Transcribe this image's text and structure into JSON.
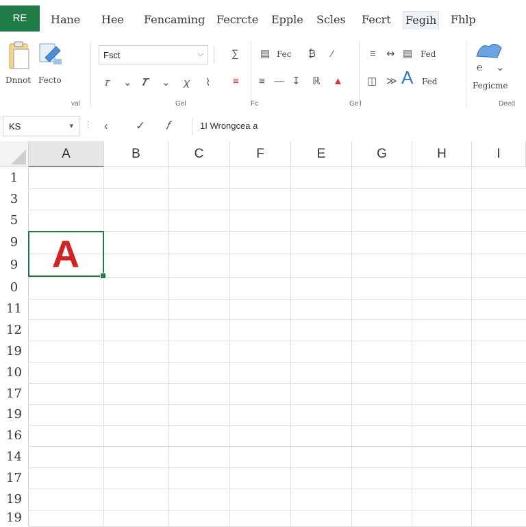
{
  "tabs": {
    "file": "RE",
    "items": [
      "Hane",
      "Hee",
      "Fencaming",
      "Fecrcte",
      "Epple",
      "Scles",
      "Fecrt",
      "Fegih",
      "Fhlp"
    ],
    "active_index": 7
  },
  "ribbon": {
    "paste_label": "Dnnot",
    "paste2_label": "Fecto",
    "font_name": "Fsct",
    "wrap_label": "Fec",
    "fill_label": "Fed",
    "styles_label": "Fegicme",
    "group_labels": [
      "val",
      "Gel",
      "Fc",
      "Gell"
    ],
    "group_labels_right": "Deed"
  },
  "formula_bar": {
    "name_box": "KS",
    "content": "1I Wrongcea a"
  },
  "grid": {
    "columns": [
      "A",
      "B",
      "C",
      "F",
      "E",
      "G",
      "H",
      "I"
    ],
    "selected_column": "A",
    "rows": [
      "1",
      "3",
      "5",
      "9",
      "9",
      "0",
      "11",
      "12",
      "19",
      "10",
      "17",
      "19",
      "16",
      "14",
      "17",
      "19",
      "19"
    ],
    "active_cell_value": "A"
  },
  "colors": {
    "file_tab": "#1e7b45",
    "selection": "#1f7a43",
    "cell_text": "#d02424"
  }
}
